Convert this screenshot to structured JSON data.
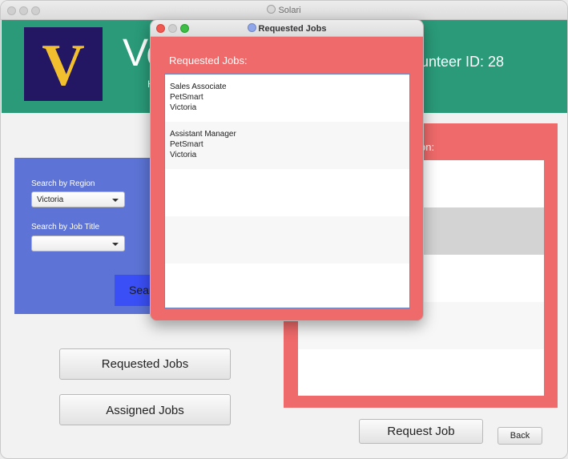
{
  "window": {
    "title": "Solari"
  },
  "header": {
    "logo_letter": "V",
    "org_title": "Ve",
    "org_subtitle": "H",
    "volunteer_id": "olunteer ID: 28"
  },
  "search": {
    "region_label": "Search by Region",
    "region_value": "Victoria",
    "job_title_label": "Search by Job Title",
    "job_title_value": "",
    "search_button": "Sear"
  },
  "buttons": {
    "requested_jobs": "Requested Jobs",
    "assigned_jobs": "Assigned Jobs",
    "request_job": "Request Job",
    "back": "Back"
  },
  "jobs_panel": {
    "label": "on:"
  },
  "popup": {
    "title": "Requested Jobs",
    "heading": "Requested Jobs:",
    "items": [
      {
        "title": "Sales Associate",
        "company": "PetSmart",
        "location": "Victoria"
      },
      {
        "title": "Assistant Manager",
        "company": "PetSmart",
        "location": "Victoria"
      }
    ]
  }
}
